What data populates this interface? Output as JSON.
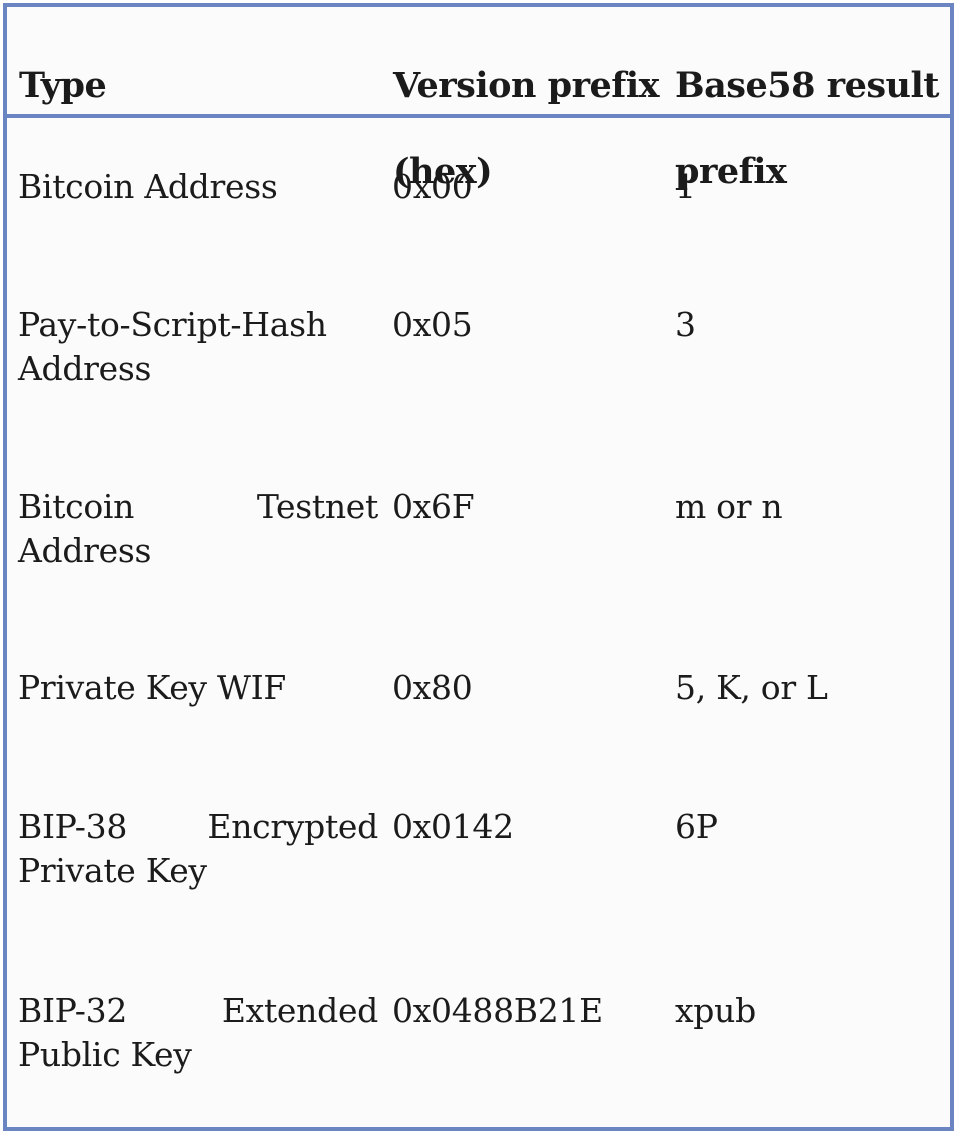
{
  "table": {
    "headers": {
      "type": "Type",
      "version_line1": "Version prefix",
      "version_line2": "(hex)",
      "base58_line1": "Base58 result",
      "base58_line2": "prefix"
    },
    "rows": [
      {
        "type_line1_a": "Bitcoin Address",
        "type_line1_b": "",
        "type_line2": "",
        "version": "0x00",
        "base58": "1"
      },
      {
        "type_line1_a": "Pay-to-Script-Hash",
        "type_line1_b": "",
        "type_line2": "Address",
        "version": "0x05",
        "base58": "3"
      },
      {
        "type_line1_a": "Bitcoin",
        "type_line1_b": "Testnet",
        "type_line2": "Address",
        "version": "0x6F",
        "base58": "m or n"
      },
      {
        "type_line1_a": "Private Key WIF",
        "type_line1_b": "",
        "type_line2": "",
        "version": "0x80",
        "base58": "5, K, or L"
      },
      {
        "type_line1_a": "BIP-38",
        "type_line1_b": "Encrypted",
        "type_line2": "Private Key",
        "version": "0x0142",
        "base58": "6P"
      },
      {
        "type_line1_a": "BIP-32",
        "type_line1_b": "Extended",
        "type_line2": "Public Key",
        "version": "0x0488B21E",
        "base58": "xpub"
      }
    ]
  }
}
